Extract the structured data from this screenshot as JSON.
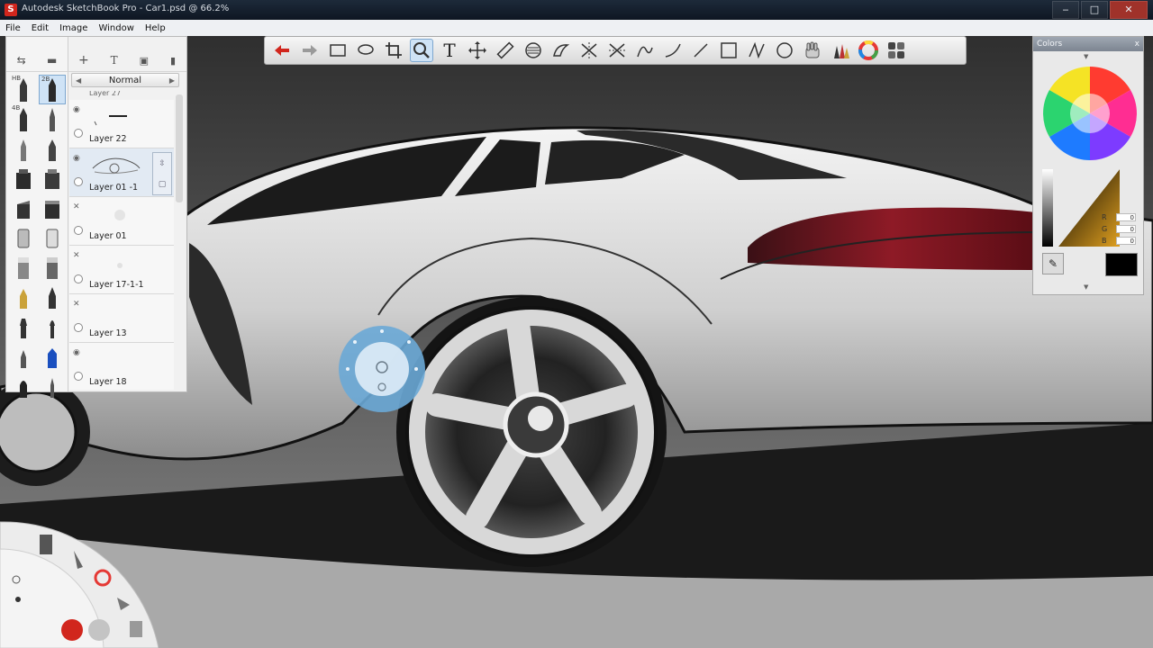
{
  "window": {
    "title": "Autodesk SketchBook Pro - Car1.psd @ 66.2%",
    "controls": [
      "‒",
      "□",
      "✕"
    ]
  },
  "menu": [
    "File",
    "Edit",
    "Image",
    "Window",
    "Help"
  ],
  "toolbar": {
    "icons": [
      "undo-icon",
      "redo-icon",
      "rect-select-icon",
      "lasso-icon",
      "crop-icon",
      "zoom-icon",
      "text-icon",
      "move-icon",
      "ruler-icon",
      "ellipse-guide-icon",
      "french-curve-icon",
      "symmetry-x-icon",
      "symmetry-y-icon",
      "stroke-icon",
      "curve-icon",
      "line-icon",
      "rectangle-icon",
      "polyline-icon",
      "ellipse-icon",
      "hand-icon",
      "brush-palette-icon",
      "color-wheel-icon",
      "swatches-icon"
    ],
    "active": "zoom-icon",
    "text_tool_glyph": "T"
  },
  "brushes": {
    "sizes": [
      "HB",
      "2B",
      "4B",
      "",
      "",
      "",
      "",
      "",
      "",
      "",
      "",
      "",
      "",
      "",
      "",
      "",
      "",
      "",
      "",
      "",
      "",
      "",
      ""
    ]
  },
  "layers": {
    "blend_mode": "Normal",
    "top_partial": "Layer 27",
    "items": [
      {
        "name": "Layer 22",
        "visible": true
      },
      {
        "name": "Layer 01 -1",
        "visible": true,
        "selected": true
      },
      {
        "name": "Layer 01",
        "visible": false
      },
      {
        "name": "Layer 17-1-1",
        "visible": false
      },
      {
        "name": "Layer 13",
        "visible": false
      },
      {
        "name": "Layer 18",
        "visible": true
      }
    ]
  },
  "colors_panel": {
    "title": "Colors",
    "close": "x",
    "r_label": "R",
    "g_label": "G",
    "b_label": "B",
    "r": "0",
    "g": "0",
    "b": "0",
    "current_color": "#000000"
  },
  "palette": {
    "accent": "#d1261d",
    "puck": "#6aa9d6"
  }
}
